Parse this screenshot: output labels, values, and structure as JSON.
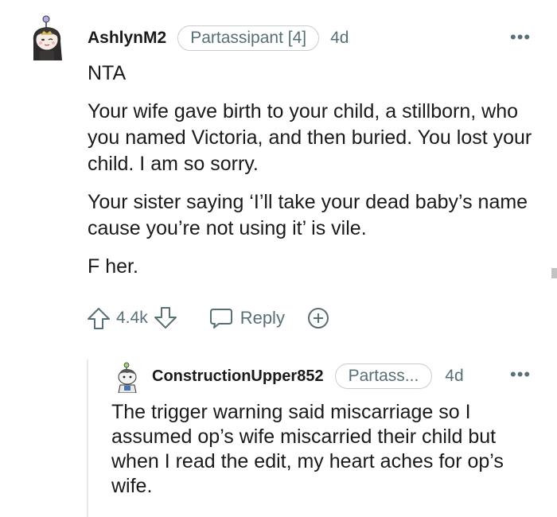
{
  "comment": {
    "author": "AshlynM2",
    "flair": "Partassipant [4]",
    "time": "4d",
    "paragraphs": [
      "NTA",
      "Your wife gave birth to your child, a stillborn, who you named Victoria, and then buried. You lost your child. I am so sorry.",
      "Your sister saying ‘I’ll take your dead baby’s name cause you’re not using it’ is vile.",
      "F her."
    ],
    "vote_count": "4.4k",
    "reply_label": "Reply"
  },
  "reply": {
    "author": "ConstructionUpper852",
    "flair": "Partass...",
    "time": "4d",
    "text": "The trigger warning said miscarriage so I assumed op’s wife miscarried their child but when I read the edit, my heart aches for op’s wife."
  },
  "icons": {
    "more": "more-options-icon",
    "upvote": "upvote-arrow-icon",
    "downvote": "downvote-arrow-icon",
    "reply": "reply-bubble-icon",
    "award": "award-plus-icon"
  },
  "colors": {
    "text": "#1a1a1b",
    "meta": "#576f76",
    "border": "#c9ccd0",
    "thread_line": "#e5e9eb"
  }
}
